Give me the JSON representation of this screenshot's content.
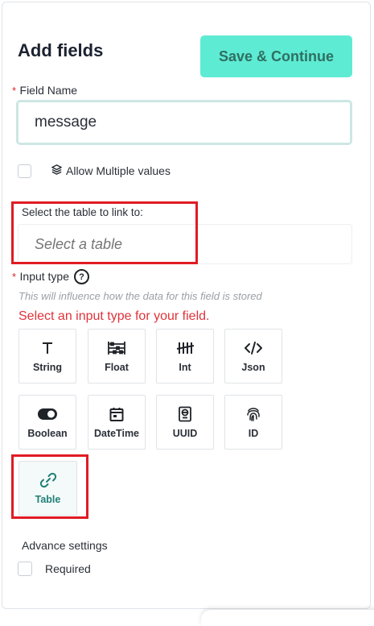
{
  "header": {
    "title": "Add fields",
    "save_label": "Save & Continue"
  },
  "field_name": {
    "required_mark": "*",
    "label": "Field Name",
    "value": "message"
  },
  "allow_multiple": {
    "label": "Allow Multiple values",
    "checked": false
  },
  "link_table": {
    "label": "Select the table to link to:",
    "placeholder": "Select a table"
  },
  "input_type": {
    "required_mark": "*",
    "label": "Input type",
    "help_glyph": "?",
    "hint": "This will influence how the data for this field is stored",
    "error": "Select an input type for your field.",
    "types": [
      {
        "label": "String",
        "icon": "text-icon"
      },
      {
        "label": "Float",
        "icon": "abacus-icon"
      },
      {
        "label": "Int",
        "icon": "tally-icon"
      },
      {
        "label": "Json",
        "icon": "code-icon"
      },
      {
        "label": "Boolean",
        "icon": "toggle-icon"
      },
      {
        "label": "DateTime",
        "icon": "calendar-icon"
      },
      {
        "label": "UUID",
        "icon": "passport-icon"
      },
      {
        "label": "ID",
        "icon": "fingerprint-icon"
      },
      {
        "label": "Table",
        "icon": "link-icon",
        "selected": true
      }
    ]
  },
  "advance": {
    "label": "Advance settings",
    "required_label": "Required",
    "required_checked": false
  },
  "colors": {
    "accent": "#5eebd3",
    "highlight": "#e01b24",
    "error": "#e0333a",
    "selected_text": "#1f7f78"
  }
}
